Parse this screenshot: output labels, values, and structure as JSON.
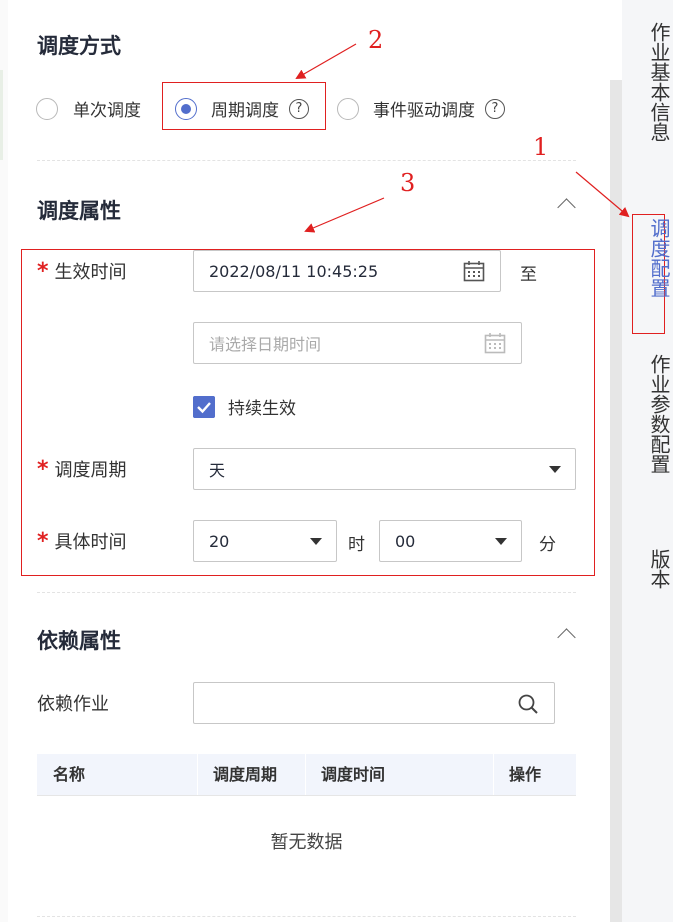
{
  "schedule_method": {
    "title": "调度方式",
    "options": [
      {
        "label": "单次调度",
        "checked": false
      },
      {
        "label": "周期调度",
        "checked": true
      },
      {
        "label": "事件驱动调度",
        "checked": false
      }
    ],
    "help_glyph": "?"
  },
  "annotations": {
    "one": "1",
    "two": "2",
    "three": "3"
  },
  "schedule_props": {
    "title": "调度属性",
    "effective_time_label": "生效时间",
    "start_value": "2022/08/11 10:45:25",
    "to_label": "至",
    "end_placeholder": "请选择日期时间",
    "continuous_label": "持续生效",
    "continuous_checked": true,
    "period_label": "调度周期",
    "period_value": "天",
    "specific_time_label": "具体时间",
    "hour_value": "20",
    "hour_unit": "时",
    "minute_value": "00",
    "minute_unit": "分",
    "required_mark": "*"
  },
  "dependency": {
    "title": "依赖属性",
    "job_label": "依赖作业",
    "columns": [
      "名称",
      "调度周期",
      "调度时间",
      "操作"
    ],
    "empty_text": "暂无数据"
  },
  "right_nav": {
    "items": [
      {
        "label": "作业基本信息",
        "active": false
      },
      {
        "label": "调度配置",
        "active": true
      },
      {
        "label": "作业参数配置",
        "active": false
      },
      {
        "label": "版本",
        "active": false
      }
    ]
  },
  "colors": {
    "accent": "#526ecc",
    "annotation": "#e02020"
  },
  "icons": [
    "calendar-icon",
    "search-icon",
    "help-icon",
    "chevron-up-icon",
    "caret-down-icon",
    "check-icon"
  ]
}
